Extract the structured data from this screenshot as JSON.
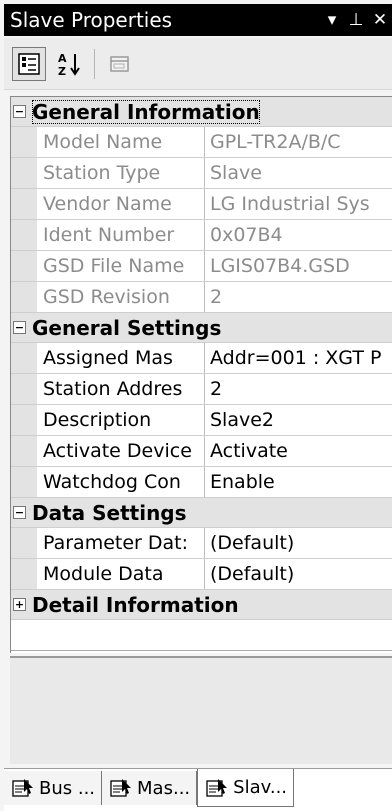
{
  "window": {
    "title": "Slave Properties",
    "dropdown_glyph": "▾",
    "pin_glyph": "⊥",
    "close_glyph": "✕"
  },
  "toolbar": {
    "categorized_icon": "categorized-icon",
    "alphabetical_icon": "alphabetical-icon",
    "alphabetical_text": "A↓Z",
    "pages_icon": "property-pages-icon"
  },
  "categories": [
    {
      "label": "General Information",
      "expanded": true,
      "focused": true,
      "rows": [
        {
          "name": "Model Name",
          "value": "GPL-TR2A/B/C",
          "readonly": true
        },
        {
          "name": "Station Type",
          "value": "Slave",
          "readonly": true
        },
        {
          "name": "Vendor Name",
          "value": "LG Industrial Sys",
          "readonly": true
        },
        {
          "name": "Ident Number",
          "value": "0x07B4",
          "readonly": true
        },
        {
          "name": "GSD File Name",
          "value": "LGIS07B4.GSD",
          "readonly": true
        },
        {
          "name": "GSD Revision",
          "value": "2",
          "readonly": true
        }
      ]
    },
    {
      "label": "General Settings",
      "expanded": true,
      "focused": false,
      "rows": [
        {
          "name": "Assigned Mas",
          "value": "Addr=001 : XGT P",
          "readonly": false
        },
        {
          "name": "Station Addres",
          "value": "2",
          "readonly": false
        },
        {
          "name": "Description",
          "value": "Slave2",
          "readonly": false
        },
        {
          "name": "Activate Device",
          "value": "Activate",
          "readonly": false
        },
        {
          "name": "Watchdog Con",
          "value": "Enable",
          "readonly": false
        }
      ]
    },
    {
      "label": "Data Settings",
      "expanded": true,
      "focused": false,
      "rows": [
        {
          "name": "Parameter Dat:",
          "value": "(Default)",
          "readonly": false
        },
        {
          "name": "Module Data",
          "value": "(Default)",
          "readonly": false
        }
      ]
    },
    {
      "label": "Detail Information",
      "expanded": false,
      "focused": false,
      "rows": []
    }
  ],
  "toggle_glyphs": {
    "expanded": "−",
    "collapsed": "+"
  },
  "tabs": [
    {
      "label": "Bus ...",
      "active": false
    },
    {
      "label": "Mas...",
      "active": false
    },
    {
      "label": "Slav...",
      "active": true
    }
  ]
}
